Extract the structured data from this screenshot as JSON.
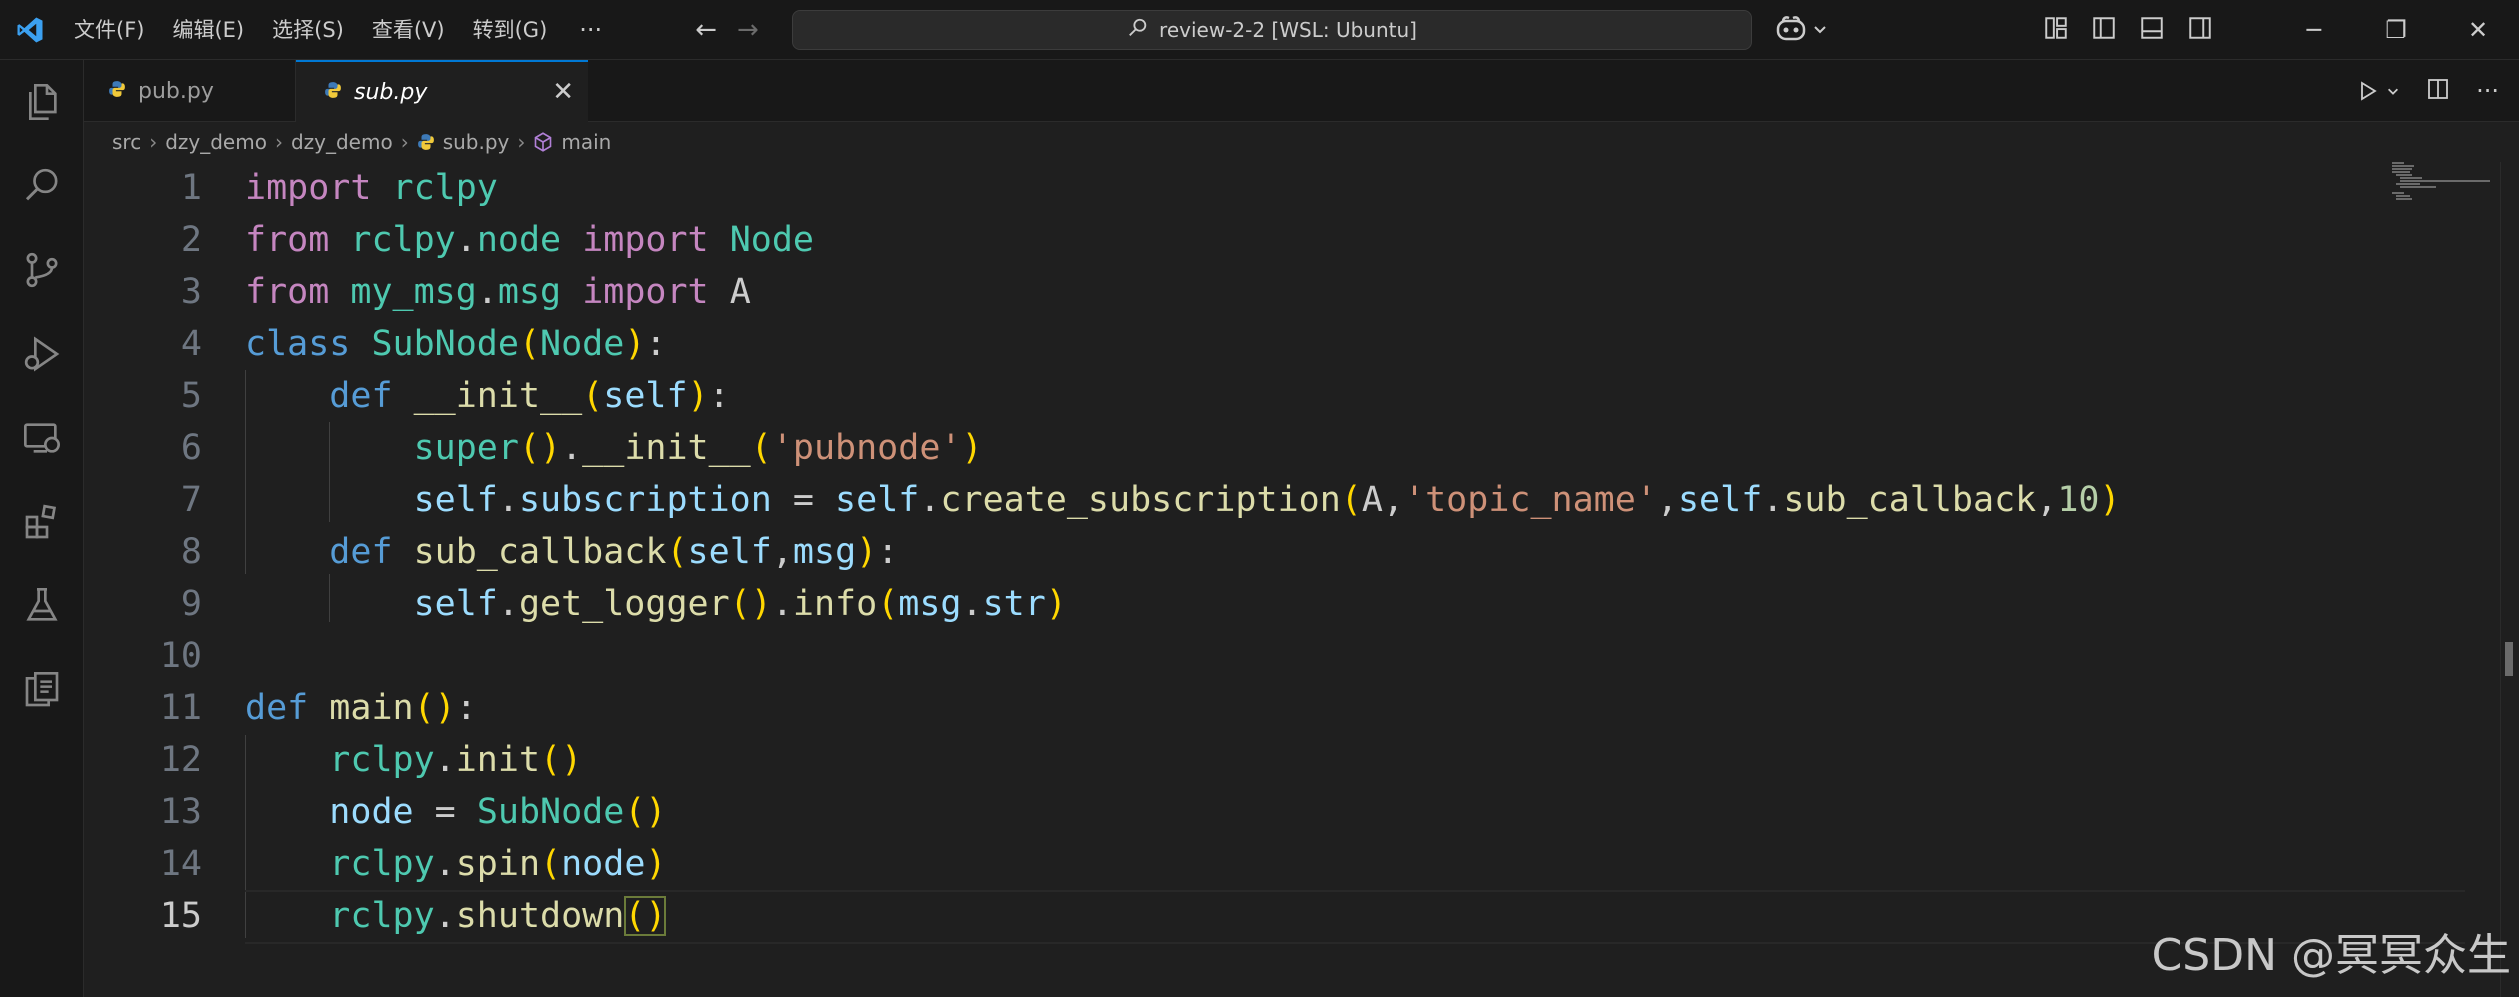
{
  "titlebar": {
    "menu": [
      "文件(F)",
      "编辑(E)",
      "选择(S)",
      "查看(V)",
      "转到(G)"
    ],
    "more": "···",
    "command_center": "review-2-2 [WSL: Ubuntu]"
  },
  "tabs": [
    {
      "label": "pub.py",
      "active": false
    },
    {
      "label": "sub.py",
      "active": true
    }
  ],
  "breadcrumb": [
    "src",
    "dzy_demo",
    "dzy_demo",
    "sub.py",
    "main"
  ],
  "code": {
    "line_numbers": [
      "1",
      "2",
      "3",
      "4",
      "5",
      "6",
      "7",
      "8",
      "9",
      "10",
      "11",
      "12",
      "13",
      "14",
      "15"
    ],
    "current_line": 15
  },
  "watermark": "CSDN @冥冥众生",
  "colors": {
    "editor_bg": "#1f1f1f",
    "accent": "#0078d4",
    "keyword": "#c586c0",
    "storage": "#569cd6",
    "class": "#4ec9b0",
    "function": "#dcdcaa",
    "variable": "#9cdcfe",
    "string": "#ce9178",
    "number": "#b5cea8",
    "bracket": "#ffd700"
  },
  "icons": [
    "vscode-logo-icon",
    "arrow-left-icon",
    "arrow-right-icon",
    "search-icon",
    "copilot-icon",
    "chevron-down-icon",
    "customize-layout-icon",
    "toggle-primary-sidebar-icon",
    "toggle-panel-icon",
    "toggle-secondary-sidebar-icon",
    "minimize-icon",
    "restore-icon",
    "close-icon",
    "explorer-icon",
    "search-view-icon",
    "source-control-icon",
    "run-debug-icon",
    "remote-explorer-icon",
    "extensions-icon",
    "testing-icon",
    "ros-icon",
    "python-file-icon",
    "run-icon",
    "split-editor-icon",
    "more-actions-icon",
    "symbol-method-icon"
  ]
}
